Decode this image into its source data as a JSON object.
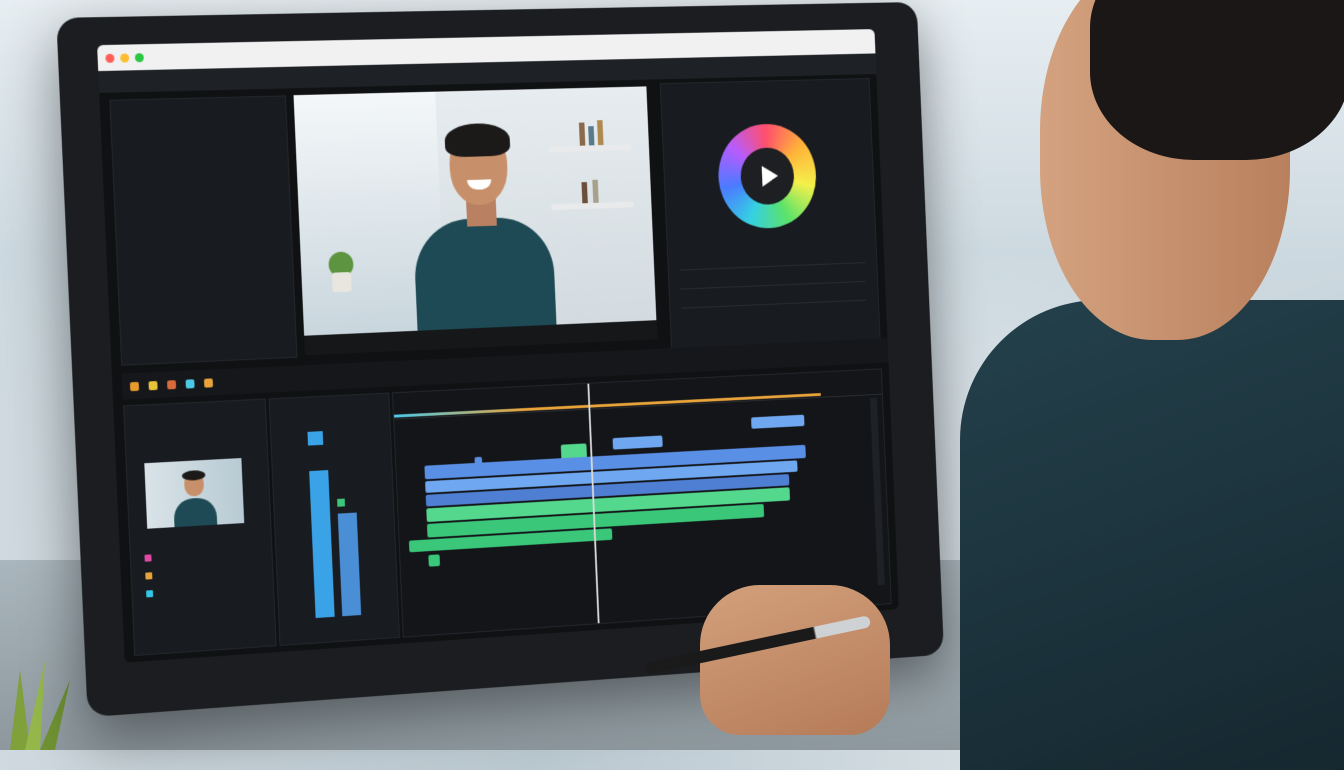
{
  "scene": {
    "description_visible_text": ""
  },
  "app": {
    "menu": [
      "",
      "",
      "",
      "",
      "",
      "",
      ""
    ]
  },
  "viewer": {
    "controls": [
      "",
      "",
      ""
    ]
  },
  "right_panel": {
    "wheel_icon": "play-icon"
  },
  "toolbar": {
    "tools": [
      "",
      "",
      "",
      "",
      ""
    ]
  },
  "project_panel": {
    "bins": [
      {
        "label": "",
        "color": "#e04aa5"
      },
      {
        "label": "",
        "color": "#e8a33a"
      },
      {
        "label": "",
        "color": "#35c6e6"
      }
    ]
  },
  "colors": {
    "accent": "#4cc9e6",
    "timeline_blue": "#5a8fe6",
    "timeline_green": "#3bc77a",
    "work_area": "#e8a33a"
  }
}
